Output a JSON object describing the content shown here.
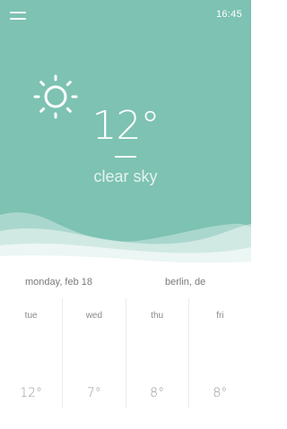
{
  "status": {
    "time": "16:45"
  },
  "icons": {
    "menu": "menu-icon",
    "weather": "sun-icon"
  },
  "current": {
    "temperature": "12°",
    "condition": "clear sky"
  },
  "info": {
    "date": "monday, feb 18",
    "location": "berlin, de"
  },
  "forecast": [
    {
      "day": "tue",
      "temp": "12°"
    },
    {
      "day": "wed",
      "temp": "7°"
    },
    {
      "day": "thu",
      "temp": "8°"
    },
    {
      "day": "fri",
      "temp": "8°"
    }
  ],
  "colors": {
    "accent": "#7dc2b2",
    "background": "#ffffff",
    "text": "#7a7a7a"
  }
}
